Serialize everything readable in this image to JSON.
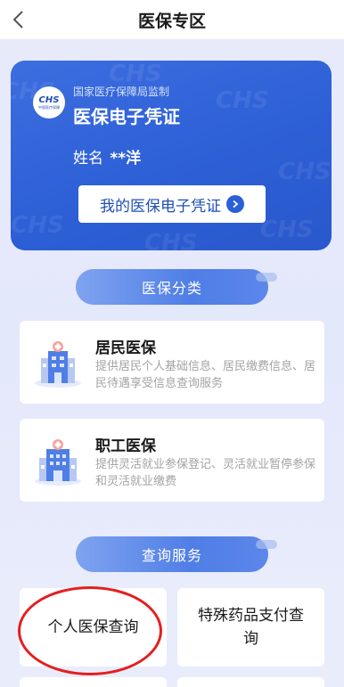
{
  "nav": {
    "title": "医保专区",
    "back_icon": "chevron-left-icon"
  },
  "credential": {
    "logo_text": "CHS",
    "logo_subtext": "中国医疗保障",
    "issuer": "国家医疗保障局监制",
    "title": "医保电子凭证",
    "name_label": "姓名",
    "name_value": "**洋",
    "button_label": "我的医保电子凭证",
    "watermark_text": "CHS",
    "colors": {
      "card": "#2d5fd6",
      "button_text": "#1f4fb8"
    }
  },
  "categories": {
    "section_label": "医保分类",
    "items": [
      {
        "title": "居民医保",
        "description": "提供居民个人基础信息、居民缴费信息、居民待遇享受信息查询服务",
        "icon": "hospital-building-icon"
      },
      {
        "title": "职工医保",
        "description": "提供灵活就业参保登记、灵活就业暂停参保和灵活就业缴费",
        "icon": "office-building-icon"
      }
    ]
  },
  "services": {
    "section_label": "查询服务",
    "items": [
      {
        "label": "个人医保查询",
        "highlighted": true,
        "highlight_color": "#e41f1f"
      },
      {
        "label": "特殊药品支付查询"
      }
    ]
  }
}
